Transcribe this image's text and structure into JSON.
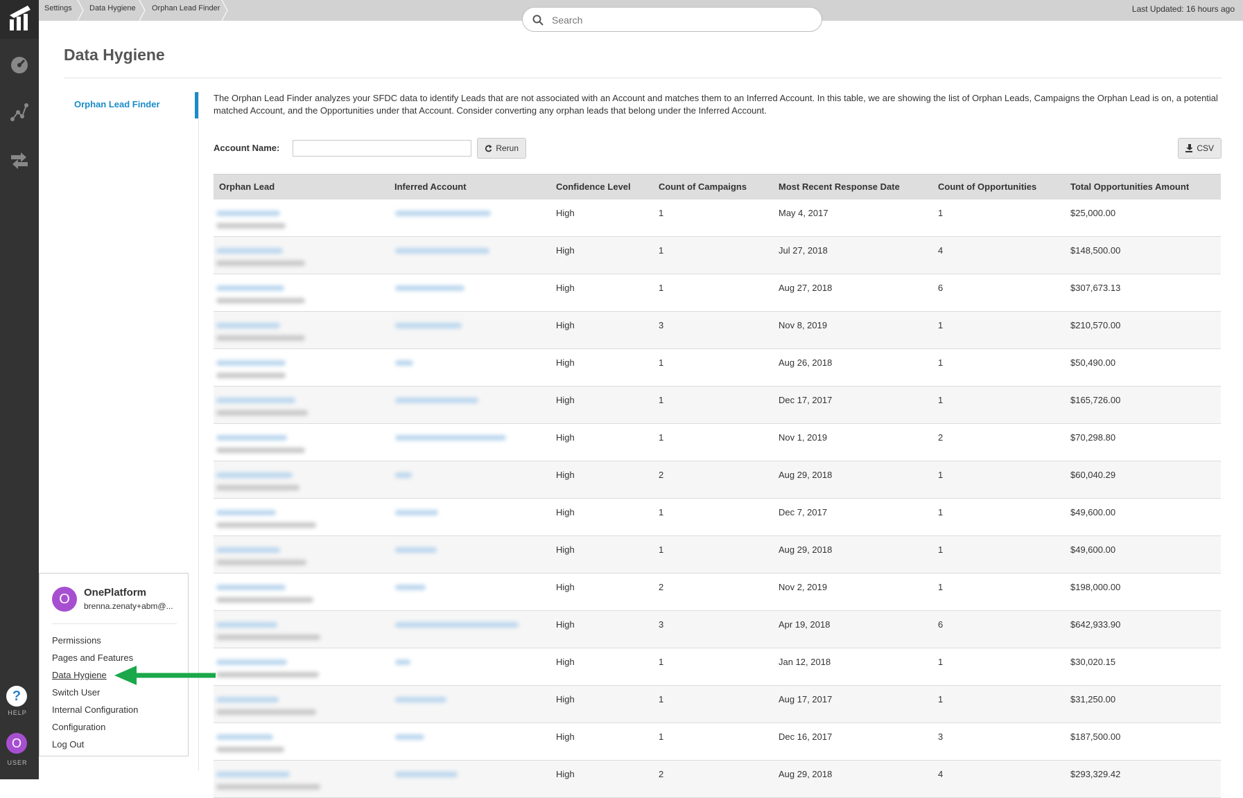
{
  "breadcrumbs": [
    "Settings",
    "Data Hygiene",
    "Orphan Lead Finder"
  ],
  "search": {
    "placeholder": "Search"
  },
  "last_updated": "Last Updated: 16 hours ago",
  "page_title": "Data Hygiene",
  "side_tab": "Orphan Lead Finder",
  "description": "The Orphan Lead Finder analyzes your SFDC data to identify Leads that are not associated with an Account and matches them to an Inferred Account. In this table, we are showing the list of Orphan Leads, Campaigns the Orphan Lead is on, a potential matched Account, and the Opportunities under that Account. Consider converting any orphan leads that belong under the Inferred Account.",
  "filter": {
    "label": "Account Name:",
    "value": "",
    "rerun_label": "Rerun",
    "csv_label": "CSV"
  },
  "table": {
    "columns": [
      "Orphan Lead",
      "Inferred Account",
      "Confidence Level",
      "Count of Campaigns",
      "Most Recent Response Date",
      "Count of Opportunities",
      "Total Opportunities Amount"
    ],
    "rows": [
      {
        "confidence": "High",
        "campaigns": "1",
        "date": "May 4, 2017",
        "opps": "1",
        "amount": "$25,000.00"
      },
      {
        "confidence": "High",
        "campaigns": "1",
        "date": "Jul 27, 2018",
        "opps": "4",
        "amount": "$148,500.00"
      },
      {
        "confidence": "High",
        "campaigns": "1",
        "date": "Aug 27, 2018",
        "opps": "6",
        "amount": "$307,673.13"
      },
      {
        "confidence": "High",
        "campaigns": "3",
        "date": "Nov 8, 2019",
        "opps": "1",
        "amount": "$210,570.00"
      },
      {
        "confidence": "High",
        "campaigns": "1",
        "date": "Aug 26, 2018",
        "opps": "1",
        "amount": "$50,490.00"
      },
      {
        "confidence": "High",
        "campaigns": "1",
        "date": "Dec 17, 2017",
        "opps": "1",
        "amount": "$165,726.00"
      },
      {
        "confidence": "High",
        "campaigns": "1",
        "date": "Nov 1, 2019",
        "opps": "2",
        "amount": "$70,298.80"
      },
      {
        "confidence": "High",
        "campaigns": "2",
        "date": "Aug 29, 2018",
        "opps": "1",
        "amount": "$60,040.29"
      },
      {
        "confidence": "High",
        "campaigns": "1",
        "date": "Dec 7, 2017",
        "opps": "1",
        "amount": "$49,600.00"
      },
      {
        "confidence": "High",
        "campaigns": "1",
        "date": "Aug 29, 2018",
        "opps": "1",
        "amount": "$49,600.00"
      },
      {
        "confidence": "High",
        "campaigns": "2",
        "date": "Nov 2, 2019",
        "opps": "1",
        "amount": "$198,000.00"
      },
      {
        "confidence": "High",
        "campaigns": "3",
        "date": "Apr 19, 2018",
        "opps": "6",
        "amount": "$642,933.90"
      },
      {
        "confidence": "High",
        "campaigns": "1",
        "date": "Jan 12, 2018",
        "opps": "1",
        "amount": "$30,020.15"
      },
      {
        "confidence": "High",
        "campaigns": "1",
        "date": "Aug 17, 2017",
        "opps": "1",
        "amount": "$31,250.00"
      },
      {
        "confidence": "High",
        "campaigns": "1",
        "date": "Dec 16, 2017",
        "opps": "3",
        "amount": "$187,500.00"
      },
      {
        "confidence": "High",
        "campaigns": "2",
        "date": "Aug 29, 2018",
        "opps": "4",
        "amount": "$293,329.42"
      }
    ]
  },
  "user_menu": {
    "avatar_letter": "O",
    "org_name": "OnePlatform",
    "email": "brenna.zenaty+abm@...",
    "items": [
      "Permissions",
      "Pages and Features",
      "Data Hygiene",
      "Switch User",
      "Internal Configuration",
      "Configuration",
      "Log Out"
    ]
  },
  "rail": {
    "help_label": "HELP",
    "user_label": "USER",
    "help_glyph": "?",
    "user_letter": "O"
  },
  "colors": {
    "accent": "#1a8bc9",
    "rail": "#333333",
    "avatar": "#a64fd1",
    "arrow": "#1aa84a"
  }
}
